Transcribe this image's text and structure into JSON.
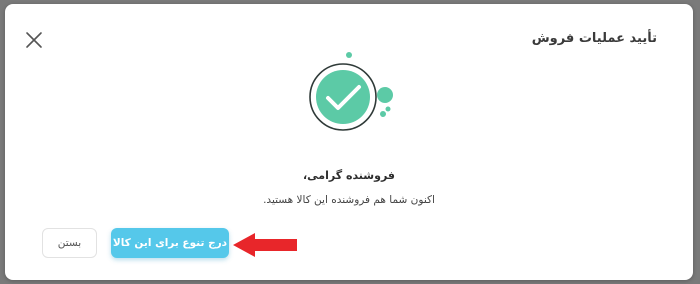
{
  "dialog": {
    "title": "تأیید عملیات فروش",
    "heading": "فروشنده گرامی،",
    "message": "اکنون شما هم فروشنده این کالا هستید.",
    "primary_button": "درج تنوع برای این کالا",
    "secondary_button": "بستن"
  },
  "icons": {
    "close": "close-icon",
    "success": "check-circle-icon",
    "annotation": "red-arrow-icon"
  },
  "colors": {
    "accent": "#55c8ea",
    "success": "#5ccaa6",
    "arrow": "#e8262a"
  }
}
